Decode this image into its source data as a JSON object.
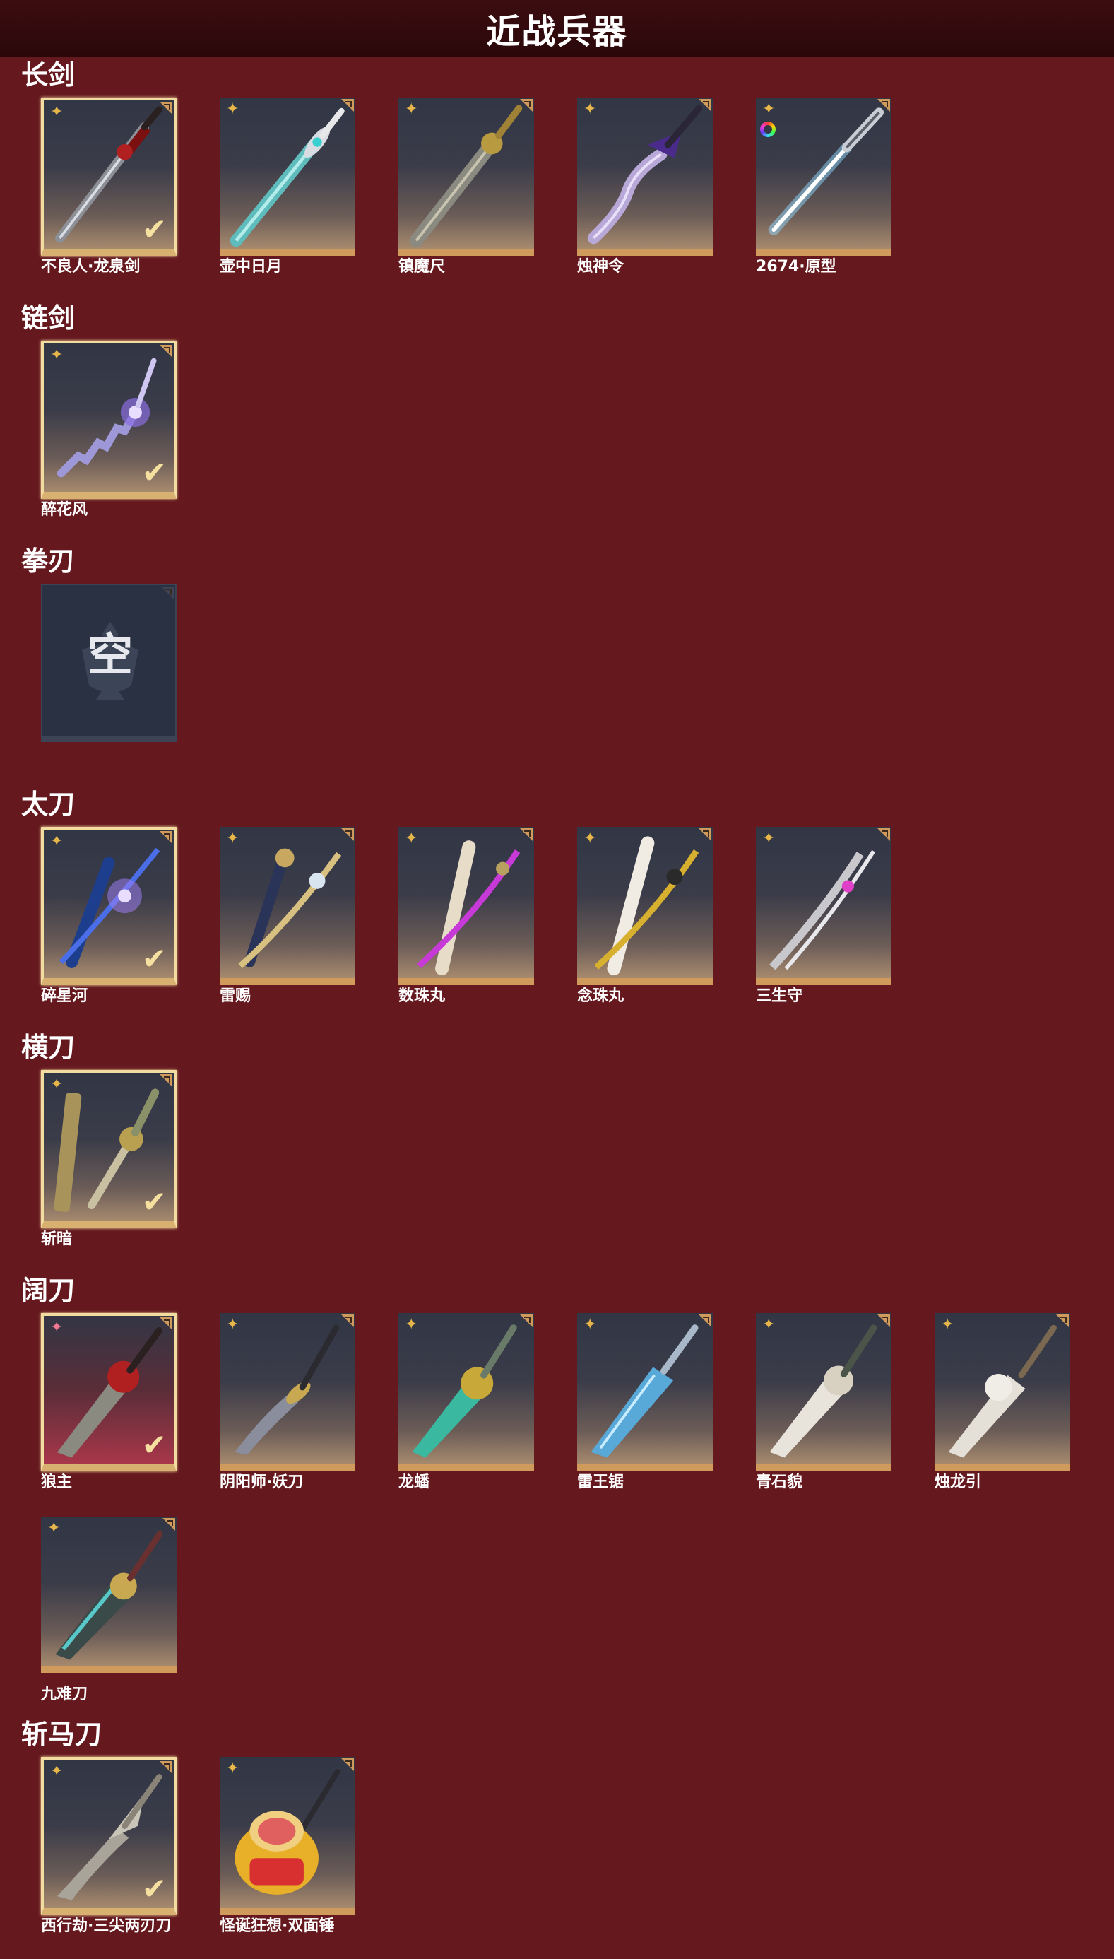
{
  "page": {
    "title": "近战兵器"
  },
  "sections": {
    "longsword": {
      "title": "长剑",
      "items": [
        "不良人·龙泉剑",
        "壶中日月",
        "镇魔尺",
        "烛神令",
        "2674·原型"
      ]
    },
    "chainsword": {
      "title": "链剑",
      "items": [
        "醉花风"
      ]
    },
    "fistblade": {
      "title": "拳刃",
      "empty_label": "空"
    },
    "taidao": {
      "title": "太刀",
      "items": [
        "碎星河",
        "雷赐",
        "数珠丸",
        "念珠丸",
        "三生守"
      ]
    },
    "hengdao": {
      "title": "横刀",
      "items": [
        "斩暗"
      ]
    },
    "kuodao": {
      "title": "阔刀",
      "items": [
        "狼主",
        "阴阳师·妖刀",
        "龙蟠",
        "雷王锯",
        "青石貌",
        "烛龙引",
        "九难刀"
      ]
    },
    "zhanmadao": {
      "title": "斩马刀",
      "items": [
        "西行劫·三尖两刃刀",
        "怪诞狂想·双面锤"
      ]
    }
  },
  "icons": {
    "rarity": "four-point-star-icon",
    "equipped": "checkmark-icon",
    "corner": "corner-tab-icon",
    "variant": "rainbow-ring-icon"
  },
  "colors": {
    "background": "#65191e",
    "header": "#2a080a",
    "gold_star": "#e6b64a",
    "pink_star": "#f07890",
    "equipped_border": "#f3dca0",
    "card_bottom": "#d09a5c"
  }
}
